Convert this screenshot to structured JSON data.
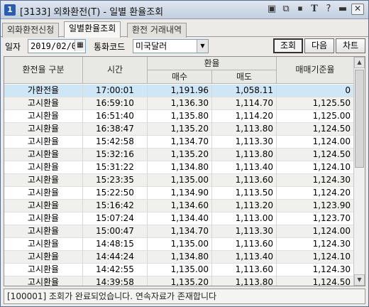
{
  "window": {
    "number": "1",
    "title": "[3133] 외화환전(T) - 일별 환율조회"
  },
  "tabs": [
    {
      "label": "외화환전신청"
    },
    {
      "label": "일별환율조회"
    },
    {
      "label": "환전 거래내역"
    }
  ],
  "filter": {
    "date_label": "일자",
    "date_value": "2019/02/07",
    "currency_label": "통화코드",
    "currency_value": "미국달러",
    "buttons": {
      "search": "조회",
      "next": "다음",
      "chart": "차트"
    }
  },
  "grid": {
    "headers": {
      "type": "환전율 구분",
      "time": "시간",
      "rate_group": "환율",
      "buy": "매수",
      "sell": "매도",
      "base": "매매기준율"
    },
    "rows": [
      [
        "가환전율",
        "17:00:01",
        "1,191.96",
        "1,058.11",
        "0"
      ],
      [
        "고시환율",
        "16:59:10",
        "1,136.30",
        "1,114.70",
        "1,125.50"
      ],
      [
        "고시환율",
        "16:51:40",
        "1,135.80",
        "1,114.20",
        "1,125.00"
      ],
      [
        "고시환율",
        "16:38:47",
        "1,135.20",
        "1,113.80",
        "1,124.50"
      ],
      [
        "고시환율",
        "15:42:58",
        "1,134.70",
        "1,113.30",
        "1,124.00"
      ],
      [
        "고시환율",
        "15:32:16",
        "1,135.20",
        "1,113.80",
        "1,124.50"
      ],
      [
        "고시환율",
        "15:31:22",
        "1,134.80",
        "1,113.40",
        "1,124.10"
      ],
      [
        "고시환율",
        "15:23:35",
        "1,135.00",
        "1,113.60",
        "1,124.30"
      ],
      [
        "고시환율",
        "15:22:50",
        "1,134.90",
        "1,113.50",
        "1,124.20"
      ],
      [
        "고시환율",
        "15:16:42",
        "1,134.60",
        "1,113.20",
        "1,123.90"
      ],
      [
        "고시환율",
        "15:07:24",
        "1,134.40",
        "1,113.00",
        "1,123.70"
      ],
      [
        "고시환율",
        "15:00:47",
        "1,134.70",
        "1,113.30",
        "1,124.00"
      ],
      [
        "고시환율",
        "14:48:15",
        "1,135.00",
        "1,113.60",
        "1,124.30"
      ],
      [
        "고시환율",
        "14:44:24",
        "1,134.80",
        "1,113.40",
        "1,124.10"
      ],
      [
        "고시환율",
        "14:42:55",
        "1,135.00",
        "1,113.60",
        "1,124.30"
      ],
      [
        "고시환율",
        "14:39:58",
        "1,135.20",
        "1,113.80",
        "1,124.50"
      ]
    ]
  },
  "status": {
    "message": "[100001] 조회가 완료되었습니다. 연속자료가 존재합니다"
  }
}
